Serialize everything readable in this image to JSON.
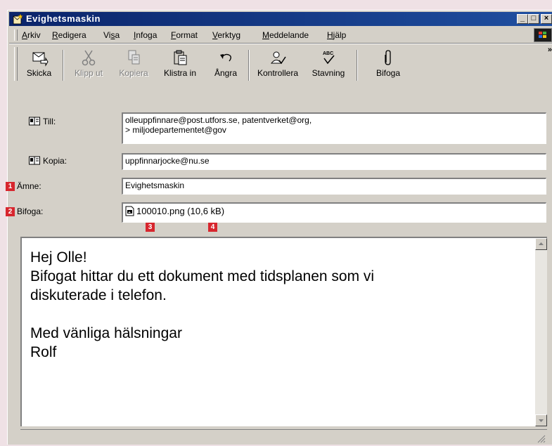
{
  "window": {
    "title": "Evighetsmaskin"
  },
  "menu": {
    "items": [
      {
        "label": "Arkiv",
        "accel": "A"
      },
      {
        "label": "Redigera",
        "accel": "R"
      },
      {
        "label": "Visa",
        "accel": "s"
      },
      {
        "label": "Infoga",
        "accel": "I"
      },
      {
        "label": "Format",
        "accel": "F"
      },
      {
        "label": "Verktyg",
        "accel": "V"
      },
      {
        "label": "Meddelande",
        "accel": "M"
      },
      {
        "label": "Hjälp",
        "accel": "H"
      }
    ]
  },
  "toolbar": {
    "send": "Skicka",
    "cut": "Klipp ut",
    "copy": "Kopiera",
    "paste": "Klistra in",
    "undo": "Ångra",
    "check": "Kontrollera",
    "spelling": "Stavning",
    "attach": "Bifoga",
    "more": "»"
  },
  "header": {
    "to_label": "Till:",
    "to_line1": "olleuppfinnare@post.utfors.se, patentverket@org,",
    "to_line2": "> miljodepartementet@gov",
    "cc_label": "Kopia:",
    "cc_value": "uppfinnarjocke@nu.se",
    "subject_label": "Ämne:",
    "subject_value": "Evighetsmaskin",
    "attach_label": "Bifoga:",
    "attach_value": "100010.png (10,6 kB)"
  },
  "callouts": [
    "1",
    "2",
    "3",
    "4"
  ],
  "message": {
    "lines": [
      "Hej Olle!",
      "Bifogat hittar du ett dokument med tidsplanen som vi",
      "diskuterade i telefon.",
      "",
      "Med vänliga hälsningar",
      "Rolf"
    ]
  },
  "colors": {
    "titlebar": "#0a246a",
    "badge": "#d7262e",
    "chrome": "#d4d0c8",
    "page": "#efe1e5"
  }
}
